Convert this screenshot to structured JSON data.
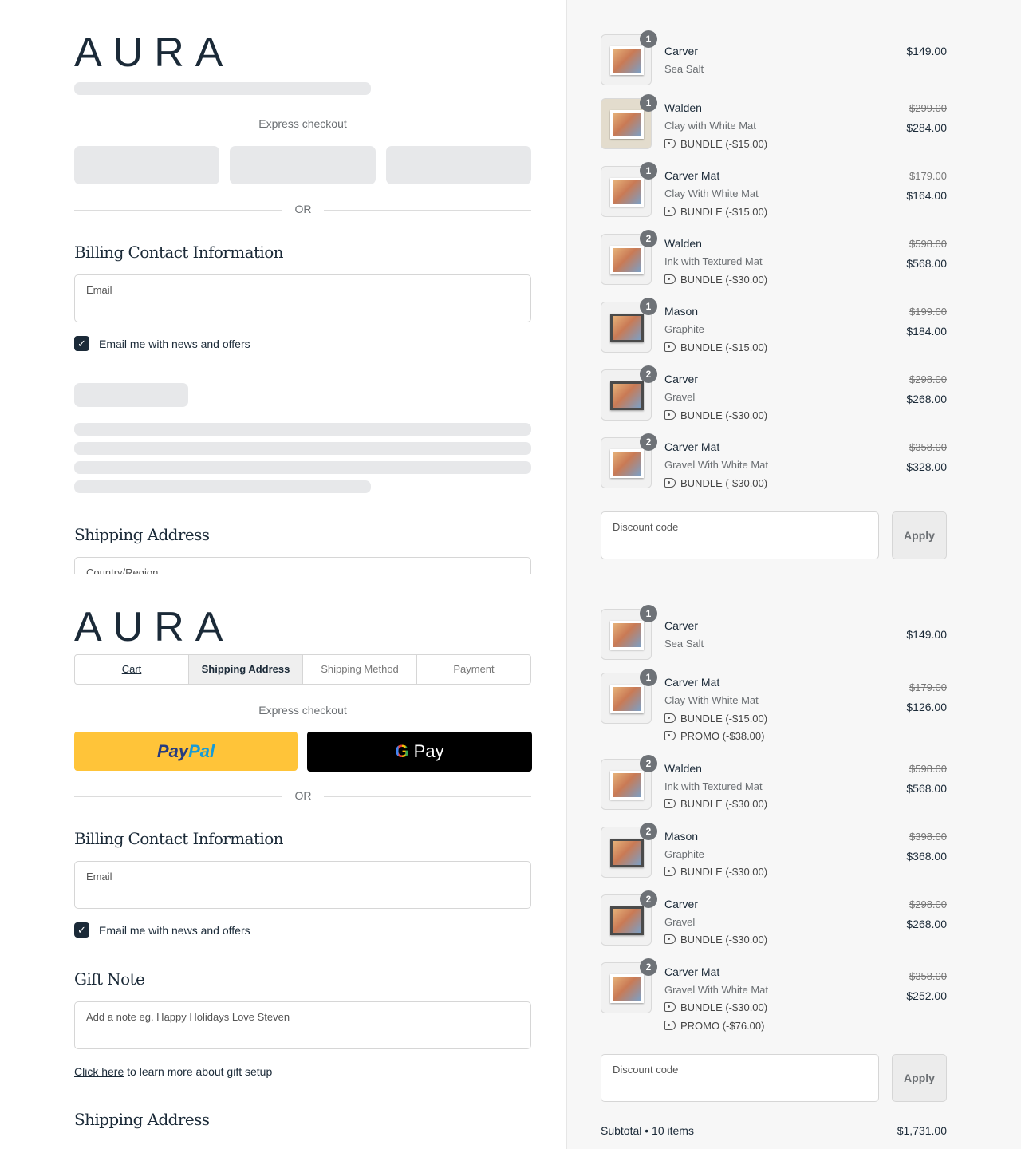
{
  "brand": {
    "logo_text": "AURA"
  },
  "top_left": {
    "express_label": "Express checkout",
    "or_label": "OR",
    "billing_title": "Billing Contact Information",
    "email_label": "Email",
    "newsletter_label": "Email me with news and offers",
    "shipping_title": "Shipping Address",
    "country_label": "Country/Region"
  },
  "bottom_left": {
    "tabs": [
      "Cart",
      "Shipping Address",
      "Shipping Method",
      "Payment"
    ],
    "express_label": "Express checkout",
    "paypal_part1": "Pay",
    "paypal_part2": "Pal",
    "gpay_g": "G",
    "gpay_text": "Pay",
    "or_label": "OR",
    "billing_title": "Billing Contact Information",
    "email_label": "Email",
    "newsletter_label": "Email me with news and offers",
    "gift_title": "Gift Note",
    "gift_placeholder": "Add a note eg. Happy Holidays Love Steven",
    "gift_link": "Click here",
    "gift_link_rest": " to learn more about gift setup",
    "shipping_title": "Shipping Address"
  },
  "cart_top": {
    "items": [
      {
        "qty": "1",
        "name": "Carver",
        "variant": "Sea Salt",
        "old": "",
        "price": "$149.00",
        "discounts": []
      },
      {
        "qty": "1",
        "name": "Walden",
        "variant": "Clay with White Mat",
        "old": "$299.00",
        "price": "$284.00",
        "discounts": [
          "BUNDLE (-$15.00)"
        ]
      },
      {
        "qty": "1",
        "name": "Carver Mat",
        "variant": "Clay With White Mat",
        "old": "$179.00",
        "price": "$164.00",
        "discounts": [
          "BUNDLE (-$15.00)"
        ]
      },
      {
        "qty": "2",
        "name": "Walden",
        "variant": "Ink with Textured Mat",
        "old": "$598.00",
        "price": "$568.00",
        "discounts": [
          "BUNDLE (-$30.00)"
        ]
      },
      {
        "qty": "1",
        "name": "Mason",
        "variant": "Graphite",
        "old": "$199.00",
        "price": "$184.00",
        "discounts": [
          "BUNDLE (-$15.00)"
        ]
      },
      {
        "qty": "2",
        "name": "Carver",
        "variant": "Gravel",
        "old": "$298.00",
        "price": "$268.00",
        "discounts": [
          "BUNDLE (-$30.00)"
        ]
      },
      {
        "qty": "2",
        "name": "Carver Mat",
        "variant": "Gravel With White Mat",
        "old": "$358.00",
        "price": "$328.00",
        "discounts": [
          "BUNDLE (-$30.00)"
        ]
      }
    ],
    "discount_label": "Discount code",
    "apply_label": "Apply"
  },
  "cart_bottom": {
    "items": [
      {
        "qty": "1",
        "name": "Carver",
        "variant": "Sea Salt",
        "old": "",
        "price": "$149.00",
        "discounts": []
      },
      {
        "qty": "1",
        "name": "Carver Mat",
        "variant": "Clay With White Mat",
        "old": "$179.00",
        "price": "$126.00",
        "discounts": [
          "BUNDLE (-$15.00)",
          "PROMO (-$38.00)"
        ]
      },
      {
        "qty": "2",
        "name": "Walden",
        "variant": "Ink with Textured Mat",
        "old": "$598.00",
        "price": "$568.00",
        "discounts": [
          "BUNDLE (-$30.00)"
        ]
      },
      {
        "qty": "2",
        "name": "Mason",
        "variant": "Graphite",
        "old": "$398.00",
        "price": "$368.00",
        "discounts": [
          "BUNDLE (-$30.00)"
        ]
      },
      {
        "qty": "2",
        "name": "Carver",
        "variant": "Gravel",
        "old": "$298.00",
        "price": "$268.00",
        "discounts": [
          "BUNDLE (-$30.00)"
        ]
      },
      {
        "qty": "2",
        "name": "Carver Mat",
        "variant": "Gravel With White Mat",
        "old": "$358.00",
        "price": "$252.00",
        "discounts": [
          "BUNDLE (-$30.00)",
          "PROMO (-$76.00)"
        ]
      }
    ],
    "discount_label": "Discount code",
    "apply_label": "Apply",
    "subtotal_label": "Subtotal • 10 items",
    "subtotal_amount": "$1,731.00"
  }
}
